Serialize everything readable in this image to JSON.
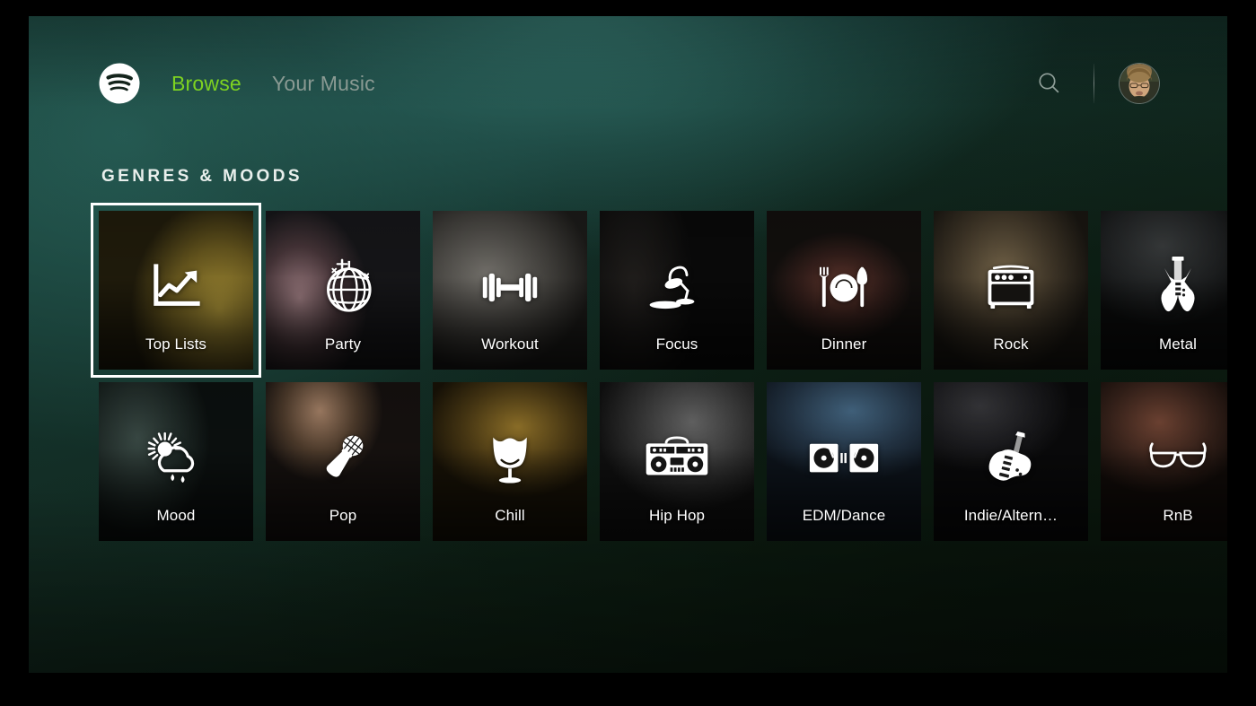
{
  "app": {
    "name": "Spotify TV",
    "accent_green": "#7ed321",
    "background_base": "#14332c"
  },
  "topbar": {
    "logo_icon": "spotify-logo-icon",
    "nav": [
      {
        "label": "Browse",
        "state": "active"
      },
      {
        "label": "Your Music",
        "state": "inactive"
      }
    ],
    "search_icon": "search-icon",
    "avatar_icon": "user-avatar"
  },
  "section": {
    "title": "GENRES & MOODS"
  },
  "grid": {
    "rows": [
      [
        {
          "label": "Top Lists",
          "icon": "trending-chart-icon",
          "selected": true
        },
        {
          "label": "Party",
          "icon": "disco-ball-icon",
          "selected": false
        },
        {
          "label": "Workout",
          "icon": "dumbbell-icon",
          "selected": false
        },
        {
          "label": "Focus",
          "icon": "desk-lamp-icon",
          "selected": false
        },
        {
          "label": "Dinner",
          "icon": "cutlery-plate-icon",
          "selected": false
        },
        {
          "label": "Rock",
          "icon": "guitar-amp-icon",
          "selected": false
        },
        {
          "label": "Metal",
          "icon": "metal-guitar-icon",
          "selected": false
        }
      ],
      [
        {
          "label": "Mood",
          "icon": "sun-cloud-rain-icon",
          "selected": false
        },
        {
          "label": "Pop",
          "icon": "microphone-icon",
          "selected": false
        },
        {
          "label": "Chill",
          "icon": "egg-chair-icon",
          "selected": false
        },
        {
          "label": "Hip Hop",
          "icon": "boombox-icon",
          "selected": false
        },
        {
          "label": "EDM/Dance",
          "icon": "turntables-icon",
          "selected": false
        },
        {
          "label": "Indie/Altern…",
          "icon": "jazzmaster-guitar-icon",
          "selected": false
        },
        {
          "label": "RnB",
          "icon": "sunglasses-icon",
          "selected": false
        }
      ]
    ]
  }
}
